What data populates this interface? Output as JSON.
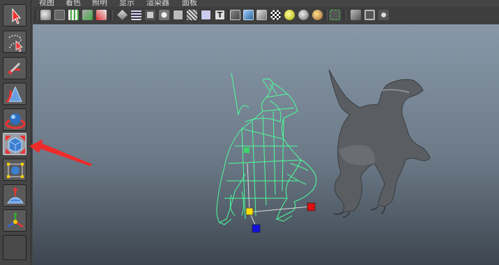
{
  "menu": [
    "视图",
    "着色",
    "照明",
    "显示",
    "渲染器",
    "面板"
  ],
  "tools": [
    {
      "name": "select-tool",
      "icon": "select-arrow-icon"
    },
    {
      "name": "lasso-tool",
      "icon": "lasso-icon"
    },
    {
      "name": "paint-select-tool",
      "icon": "paint-brush-icon"
    },
    {
      "name": "move-tool",
      "icon": "move-icon"
    },
    {
      "name": "rotate-tool",
      "icon": "rotate-icon"
    },
    {
      "name": "scale-tool",
      "icon": "scale-icon",
      "active": true
    },
    {
      "name": "universal-manipulator",
      "icon": "manipulator-icon"
    },
    {
      "name": "soft-modification-tool",
      "icon": "soft-mod-icon"
    },
    {
      "name": "show-manipulator-tool",
      "icon": "transform-axes-icon"
    },
    {
      "name": "last-used-tool",
      "icon": "empty-slot-icon"
    }
  ],
  "colors": {
    "wireframe": "#4dff9a",
    "annotation_arrow": "#ee2b2b",
    "pivot_y": "#ffe000",
    "pivot_x": "#dd1111",
    "pivot_z": "#1111dd"
  }
}
